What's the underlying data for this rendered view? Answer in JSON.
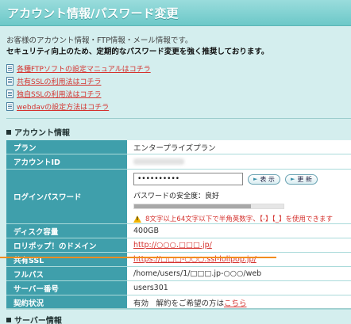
{
  "header": {
    "title": "アカウント情報/パスワード変更"
  },
  "intro": {
    "line1": "お客様のアカウント情報・FTP情報・メール情報です。",
    "line2": "セキュリティ向上のため、定期的なパスワード変更を強く推奨しております。"
  },
  "links": [
    {
      "icon": "document-icon",
      "label": "各種FTPソフトの設定マニュアルはコチラ"
    },
    {
      "icon": "document-icon",
      "label": "共有SSLの利用法はコチラ"
    },
    {
      "icon": "document-icon",
      "label": "独自SSLの利用法はコチラ"
    },
    {
      "icon": "document-icon",
      "label": "webdavの設定方法はコチラ"
    }
  ],
  "account_section": {
    "title": "アカウント情報"
  },
  "rows": {
    "plan": {
      "label": "プラン",
      "value": "エンタープライズプラン"
    },
    "account_id": {
      "label": "アカウントID"
    },
    "password": {
      "label": "ログインパスワード",
      "value": "••••••••••",
      "show_button": "表 示",
      "update_button": "更 新",
      "strength_label": "パスワードの安全度：良好",
      "strength_level": 0.78,
      "warning": "8文字以上64文字以下で半角英数字、【-】【_】を使用できます"
    },
    "disk": {
      "label": "ディスク容量",
      "value": "400GB"
    },
    "domain": {
      "label": "ロリポップ！のドメイン",
      "value": "http://○○○.□□□.jp/"
    },
    "shared_ssl": {
      "label": "共有SSL",
      "value": "https://□□□-○○○.ssl-lolipop.jp/"
    },
    "full_path": {
      "label": "フルパス",
      "value": "/home/users/1/□□□.jp-○○○/web"
    },
    "server_no": {
      "label": "サーバー番号",
      "value": "users301"
    },
    "contract": {
      "label": "契約状況",
      "value": "有効　解約をご希望の方は",
      "link": "こちら"
    }
  },
  "server_section": {
    "title": "サーバー情報"
  },
  "colors": {
    "header_cell": "#3f9fab",
    "link": "#d4322e",
    "highlight": "#f28c1e",
    "background": "#d4eeee"
  }
}
